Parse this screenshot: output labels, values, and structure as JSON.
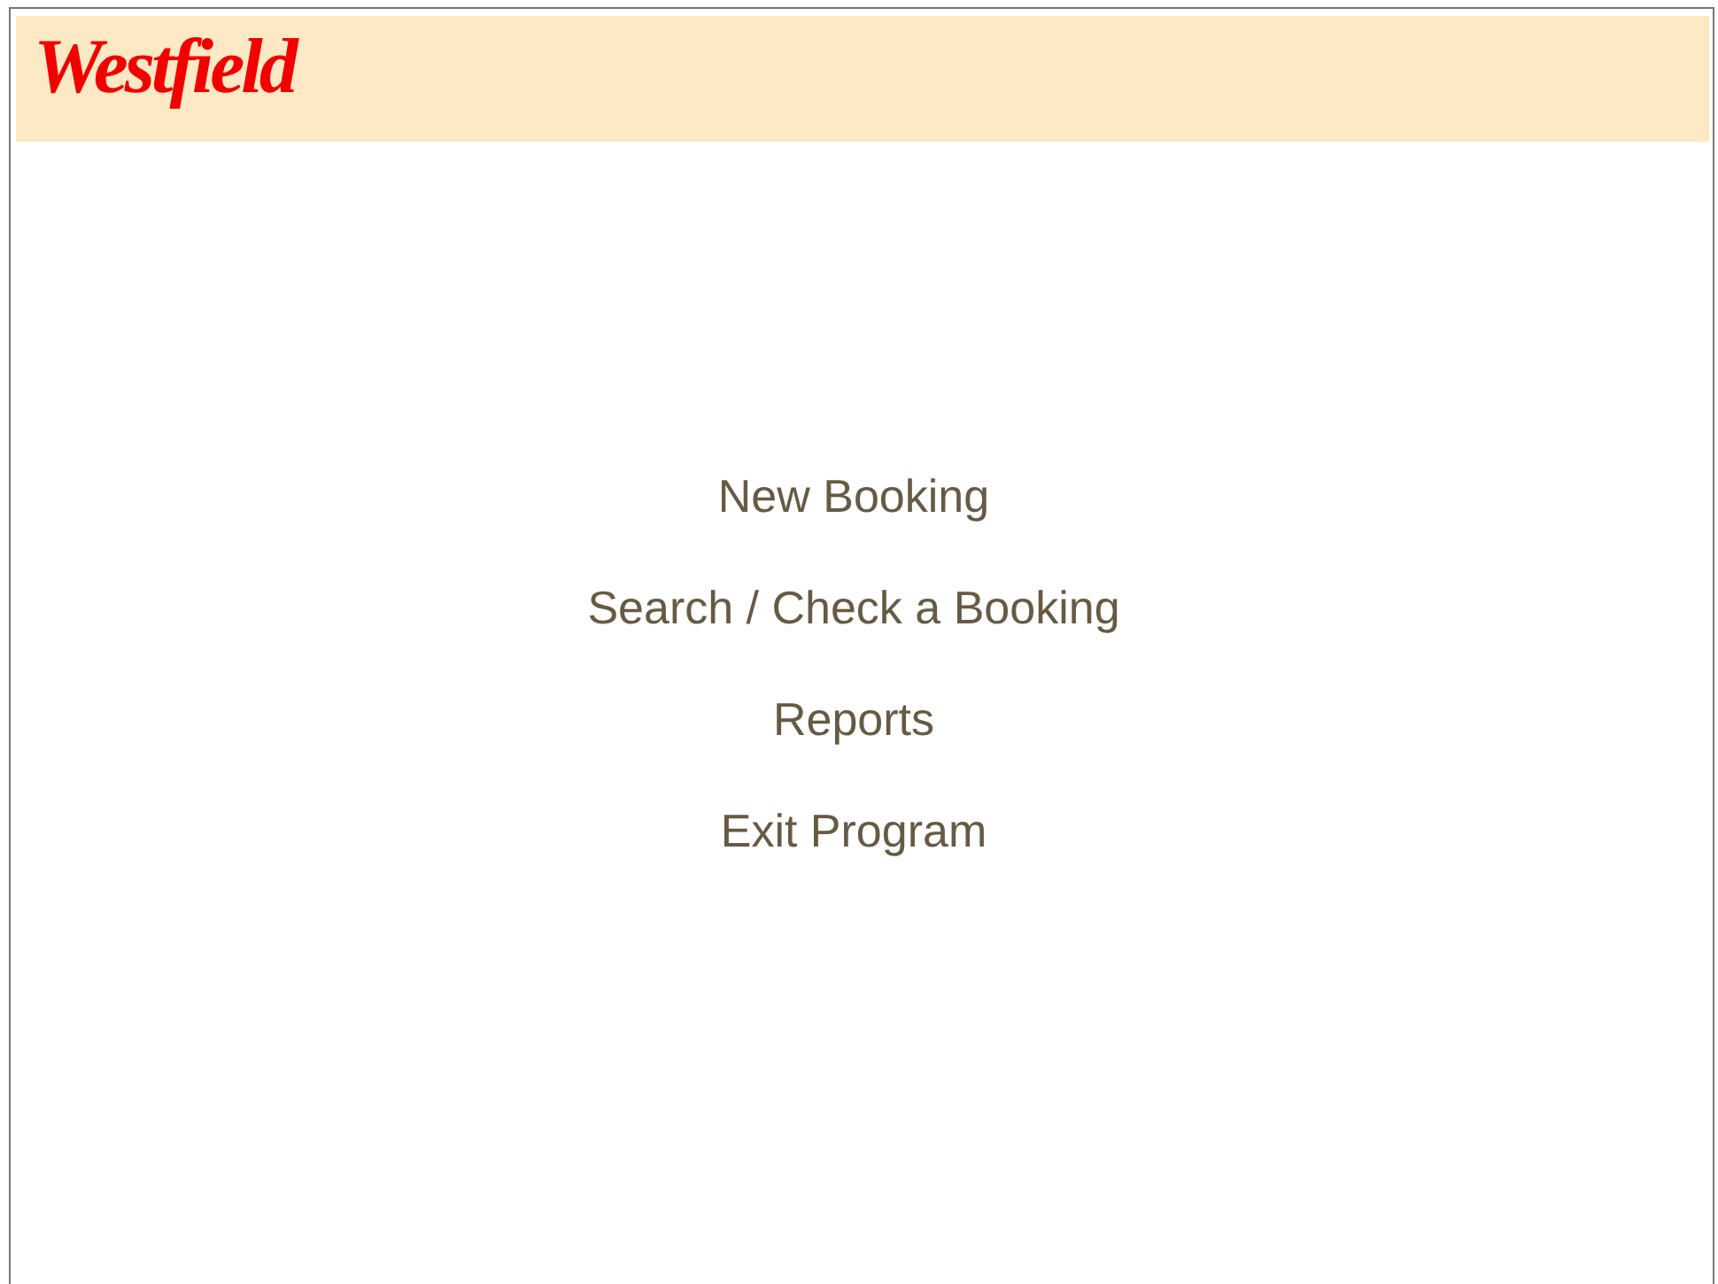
{
  "header": {
    "logo": "Westfield"
  },
  "menu": [
    {
      "label": "New Booking"
    },
    {
      "label": "Search / Check a Booking"
    },
    {
      "label": "Reports"
    },
    {
      "label": "Exit Program"
    }
  ]
}
